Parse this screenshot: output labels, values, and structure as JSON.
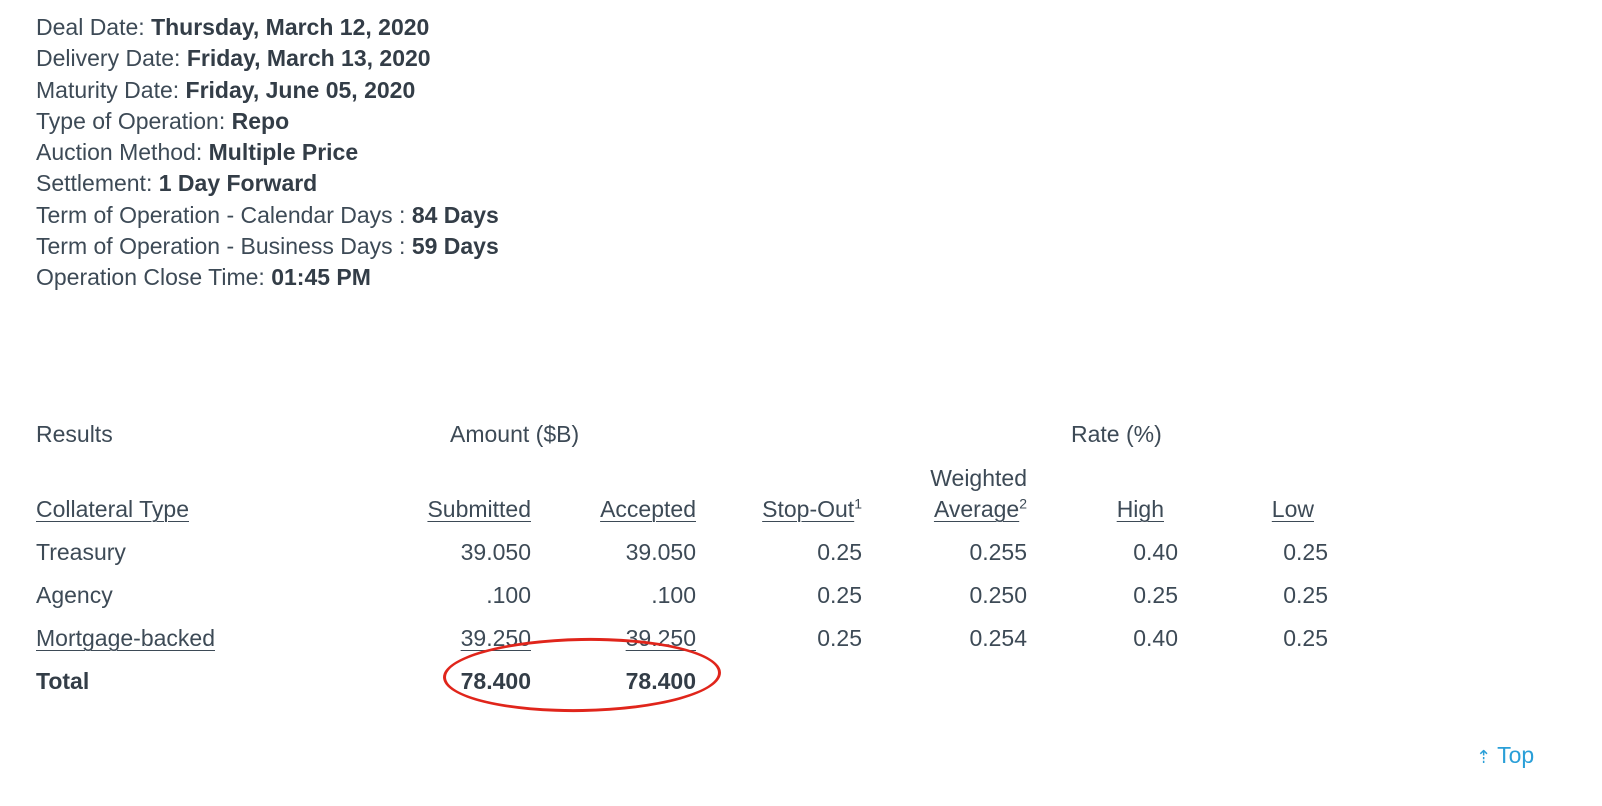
{
  "details": [
    {
      "label": "Deal Date: ",
      "value": "Thursday, March 12, 2020"
    },
    {
      "label": "Delivery Date: ",
      "value": "Friday, March 13, 2020"
    },
    {
      "label": "Maturity Date: ",
      "value": "Friday, June 05, 2020"
    },
    {
      "label": "Type of Operation: ",
      "value": "Repo"
    },
    {
      "label": "Auction Method: ",
      "value": "Multiple Price"
    },
    {
      "label": "Settlement: ",
      "value": "1 Day Forward"
    },
    {
      "label": "Term of Operation - Calendar Days : ",
      "value": "84 Days"
    },
    {
      "label": "Term of Operation - Business Days : ",
      "value": "59 Days"
    },
    {
      "label": "Operation Close Time: ",
      "value": "01:45 PM"
    }
  ],
  "results": {
    "section_label": "Results",
    "amount_group": "Amount ($B)",
    "rate_group": "Rate (%)",
    "columns": {
      "collateral_type": "Collateral Type",
      "submitted": "Submitted",
      "accepted": "Accepted",
      "stop_out": "Stop-Out",
      "stop_out_note": "1",
      "weighted_line1": "Weighted",
      "weighted_line2": "Average",
      "weighted_note": "2",
      "high": "High",
      "low": "Low"
    },
    "rows": [
      {
        "type": "Treasury",
        "submitted": "39.050",
        "accepted": "39.050",
        "stop_out": "0.25",
        "weighted": "0.255",
        "high": "0.40",
        "low": "0.25"
      },
      {
        "type": "Agency",
        "submitted": ".100",
        "accepted": ".100",
        "stop_out": "0.25",
        "weighted": "0.250",
        "high": "0.25",
        "low": "0.25"
      },
      {
        "type": "Mortgage-backed",
        "submitted": "39.250",
        "accepted": "39.250",
        "stop_out": "0.25",
        "weighted": "0.254",
        "high": "0.40",
        "low": "0.25"
      }
    ],
    "total": {
      "label": "Total",
      "submitted": "78.400",
      "accepted": "78.400"
    }
  },
  "top_link": {
    "arrow": "⇡",
    "label": "Top"
  },
  "colors": {
    "text": "#3d4a56",
    "link": "#2a9fd8",
    "highlight": "#e0251b"
  }
}
